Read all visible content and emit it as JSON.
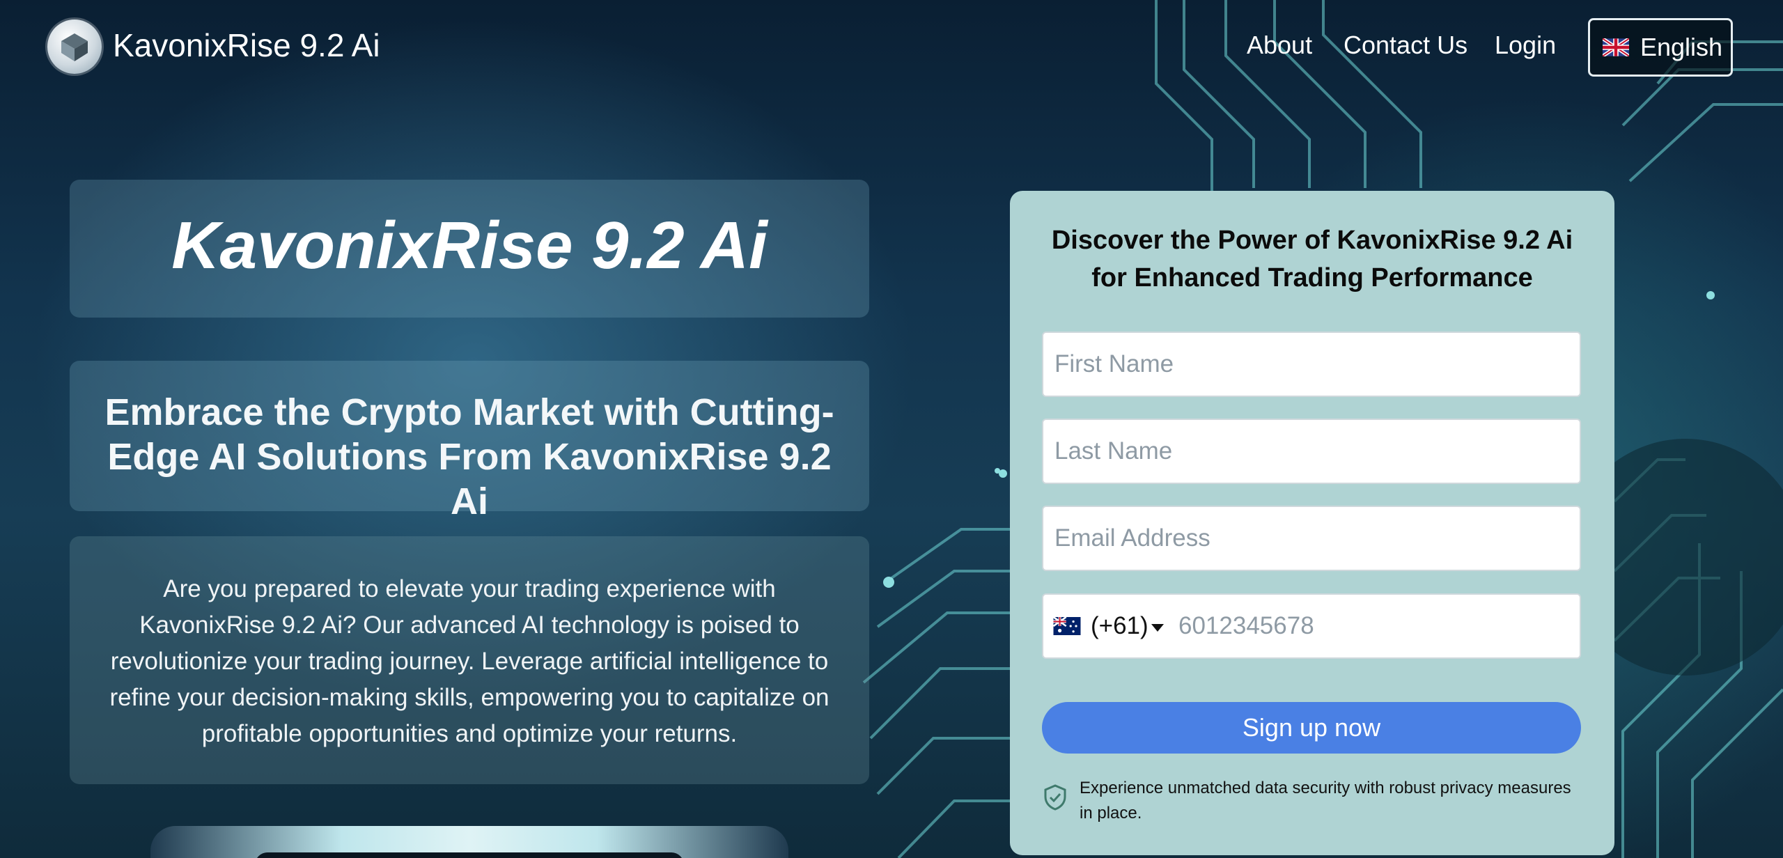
{
  "header": {
    "brand": "KavonixRise 9.2 Ai",
    "nav": [
      {
        "label": "About"
      },
      {
        "label": "Contact Us"
      },
      {
        "label": "Login"
      }
    ],
    "language": "English"
  },
  "hero": {
    "title": "KavonixRise 9.2 Ai",
    "subtitle": "Embrace the Crypto Market with Cutting-Edge AI Solutions From KavonixRise 9.2 Ai",
    "body": "Are you prepared to elevate your trading experience with KavonixRise 9.2 Ai? Our advanced AI technology is poised to revolutionize your trading journey. Leverage artificial intelligence to refine your decision-making skills, empowering you to capitalize on profitable opportunities and optimize your returns."
  },
  "form": {
    "title": "Discover the Power of KavonixRise 9.2 Ai for Enhanced Trading Performance",
    "first_name_placeholder": "First Name",
    "last_name_placeholder": "Last Name",
    "email_placeholder": "Email Address",
    "phone_code": "(+61)",
    "phone_placeholder": "6012345678",
    "submit_label": "Sign up now",
    "security_note": "Experience unmatched data security with robust privacy measures in place."
  },
  "colors": {
    "panel_bg": "#afd3d3",
    "button": "#4a80e4",
    "page_bg": "#12344e"
  },
  "icons": {
    "logo": "cube-logo-icon",
    "language_flag": "uk-flag-icon",
    "phone_flag": "australia-flag-icon",
    "security": "shield-check-icon"
  }
}
